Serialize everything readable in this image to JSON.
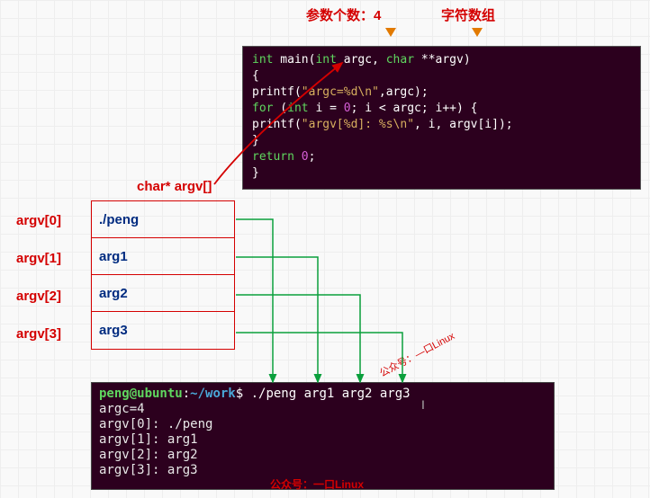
{
  "top": {
    "count_label": "参数个数：4",
    "arr_label": "字符数组"
  },
  "side_label": "char* argv[]",
  "argv_idx": [
    "argv[0]",
    "argv[1]",
    "argv[2]",
    "argv[3]"
  ],
  "argv_values": [
    "./peng",
    "arg1",
    "arg2",
    "arg3"
  ],
  "code": {
    "l0a": "int",
    "l0b": " main(",
    "l0c": "int",
    "l0d": " argc, ",
    "l0e": "char",
    "l0f": " **argv)",
    "l1": "{",
    "l2a": "    printf(",
    "l2b": "\"argc=%d\\n\"",
    "l2c": ",argc);",
    "l3a": "    for",
    "l3b": " (",
    "l3c": "int",
    "l3d": " i = ",
    "l3e": "0",
    "l3f": "; i < argc; i++) {",
    "l4a": "        printf(",
    "l4b": "\"argv[%d]: %s\\n\"",
    "l4c": ", i, argv[i]);",
    "l5": "    }",
    "l6a": "    return",
    "l6b": " 0",
    "l6c": ";",
    "l7": "}"
  },
  "terminal": {
    "user": "peng@ubuntu",
    "colon": ":",
    "path": "~/work",
    "dollar": "$ ",
    "cmd": "./peng arg1 arg2 arg3",
    "out": [
      "argc=4",
      "argv[0]: ./peng",
      "argv[1]: arg1",
      "argv[2]: arg2",
      "argv[3]: arg3"
    ],
    "watermark": "公众号：一口Linux"
  },
  "watermark2": "—口Linux",
  "watermark2_pre": "公众号："
}
